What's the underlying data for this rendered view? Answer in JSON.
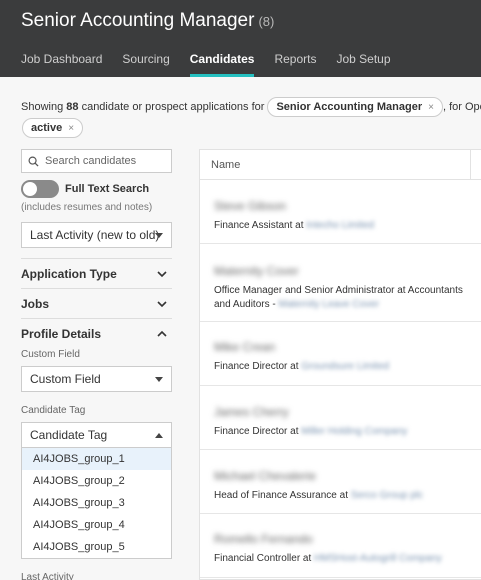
{
  "header": {
    "title": "Senior Accounting Manager",
    "count": "(8)",
    "tabs": [
      {
        "label": "Job Dashboard",
        "active": false
      },
      {
        "label": "Sourcing",
        "active": false
      },
      {
        "label": "Candidates",
        "active": true
      },
      {
        "label": "Reports",
        "active": false
      },
      {
        "label": "Job Setup",
        "active": false
      }
    ]
  },
  "filter": {
    "prefix": "Showing ",
    "count": "88",
    "text": " candidate or prospect applications for ",
    "job_pill": "Senior Accounting Manager",
    "suffix": ", for Open jobs",
    "status_pill": "active",
    "remove_glyph": "×"
  },
  "sidebar": {
    "search_placeholder": "Search candidates",
    "full_text_label": "Full Text Search",
    "full_text_enabled": false,
    "full_text_hint": "(includes resumes and notes)",
    "sort_value": "Last Activity (new to old)",
    "sections": {
      "application_type": "Application Type",
      "jobs": "Jobs",
      "profile_details": "Profile Details"
    },
    "custom_field_label": "Custom Field",
    "custom_field_value": "Custom Field",
    "candidate_tag_label": "Candidate Tag",
    "candidate_tag_value": "Candidate Tag",
    "tag_options": [
      "AI4JOBS_group_1",
      "AI4JOBS_group_2",
      "AI4JOBS_group_3",
      "AI4JOBS_group_4",
      "AI4JOBS_group_5"
    ],
    "last_activity_label": "Last Activity"
  },
  "table": {
    "column_name": "Name",
    "rows": [
      {
        "name": "Steve Gibson",
        "role": "Finance Assistant at ",
        "company": "Intecho Limited"
      },
      {
        "name": "Maternity Cover",
        "role": "Office Manager and Senior Administrator at Accountants and Auditors - ",
        "company": "Maternity Leave Cover"
      },
      {
        "name": "Mike Crean",
        "role": "Finance Director at ",
        "company": "Groundsure Limited"
      },
      {
        "name": "James Cherry",
        "role": "Finance Director at ",
        "company": "Miller Holding Company"
      },
      {
        "name": "Michael Chevalerie",
        "role": "Head of Finance Assurance at ",
        "company": "Serco Group plc"
      },
      {
        "name": "Romello Fernando",
        "role": "Financial Controller at ",
        "company": "HMSHost-Autogrill Company"
      }
    ]
  },
  "colors": {
    "topbar": "#3b3c3d",
    "accent": "#25c0c0",
    "highlight": "#e8f2fb"
  },
  "icons": {
    "search": "search-icon",
    "chevron_down": "chevron-down-icon",
    "chevron_up": "chevron-up-icon",
    "caret": "caret-down-icon"
  }
}
